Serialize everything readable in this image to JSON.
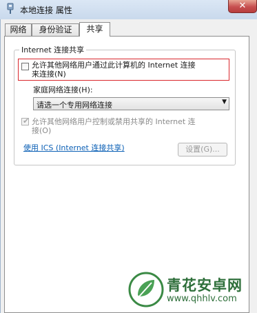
{
  "window": {
    "title": "本地连接 属性",
    "close_glyph": "✕"
  },
  "tabs": [
    {
      "label": "网络",
      "active": false
    },
    {
      "label": "身份验证",
      "active": false
    },
    {
      "label": "共享",
      "active": true
    }
  ],
  "sharing": {
    "group_label": "Internet 连接共享",
    "allow_share": {
      "label_line1": "允许其他网络用户通过此计算机的 Internet 连接",
      "label_line2": "来连接(N)",
      "checked": false
    },
    "home_network_label": "家庭网络连接(H):",
    "home_network_select": {
      "value": "请选一个专用网络连接"
    },
    "allow_control": {
      "label_line1": "允许其他网络用户控制或禁用共享的 Internet 连",
      "label_line2": "接(O)",
      "checked": true,
      "disabled": true
    },
    "ics_link": "使用 ICS (Internet 连接共享)",
    "settings_button": "设置(G)..."
  },
  "watermark": {
    "name": "青花安卓网",
    "url": "www.qhhlv.com"
  },
  "colors": {
    "highlight": "#d9262b",
    "link": "#0a5fb5",
    "close": "#c75050"
  },
  "icons": {
    "window": "network-adapter-icon",
    "close": "close-icon",
    "dropdown": "chevron-down-icon",
    "check": "checkmark-icon",
    "watermark": "leaf-logo-icon"
  }
}
